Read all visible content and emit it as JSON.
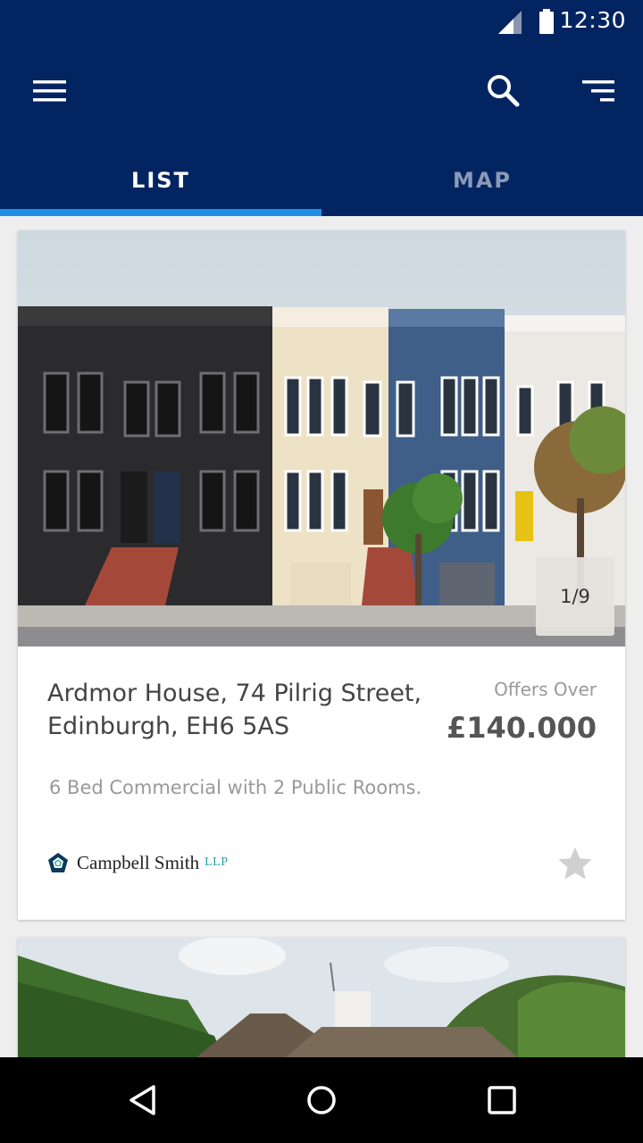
{
  "status_bar": {
    "time": "12:30",
    "icons": [
      "signal-icon",
      "battery-icon"
    ]
  },
  "toolbar": {
    "icons": [
      "menu-icon",
      "search-icon",
      "sort-filter-icon"
    ]
  },
  "tabs": [
    {
      "label": "LIST",
      "selected": true
    },
    {
      "label": "MAP",
      "selected": false
    }
  ],
  "listing": {
    "photo_counter": "1/9",
    "address": "Ardmor House, 74 Pilrig Street, Edinburgh, EH6 5AS",
    "price_qualifier": "Offers Over",
    "price": "£140.000",
    "description": "6 Bed Commercial with 2 Public Rooms.",
    "agent": {
      "name": "Campbell Smith",
      "suffix": "LLP"
    },
    "favorite_icon": "star-icon"
  },
  "colors": {
    "app_bar": "#022561",
    "tab_indicator": "#1f8fe5",
    "agent_accent": "#1ea3a8"
  },
  "nav_bar": {
    "icons": [
      "back-icon",
      "home-icon",
      "recents-icon"
    ]
  }
}
